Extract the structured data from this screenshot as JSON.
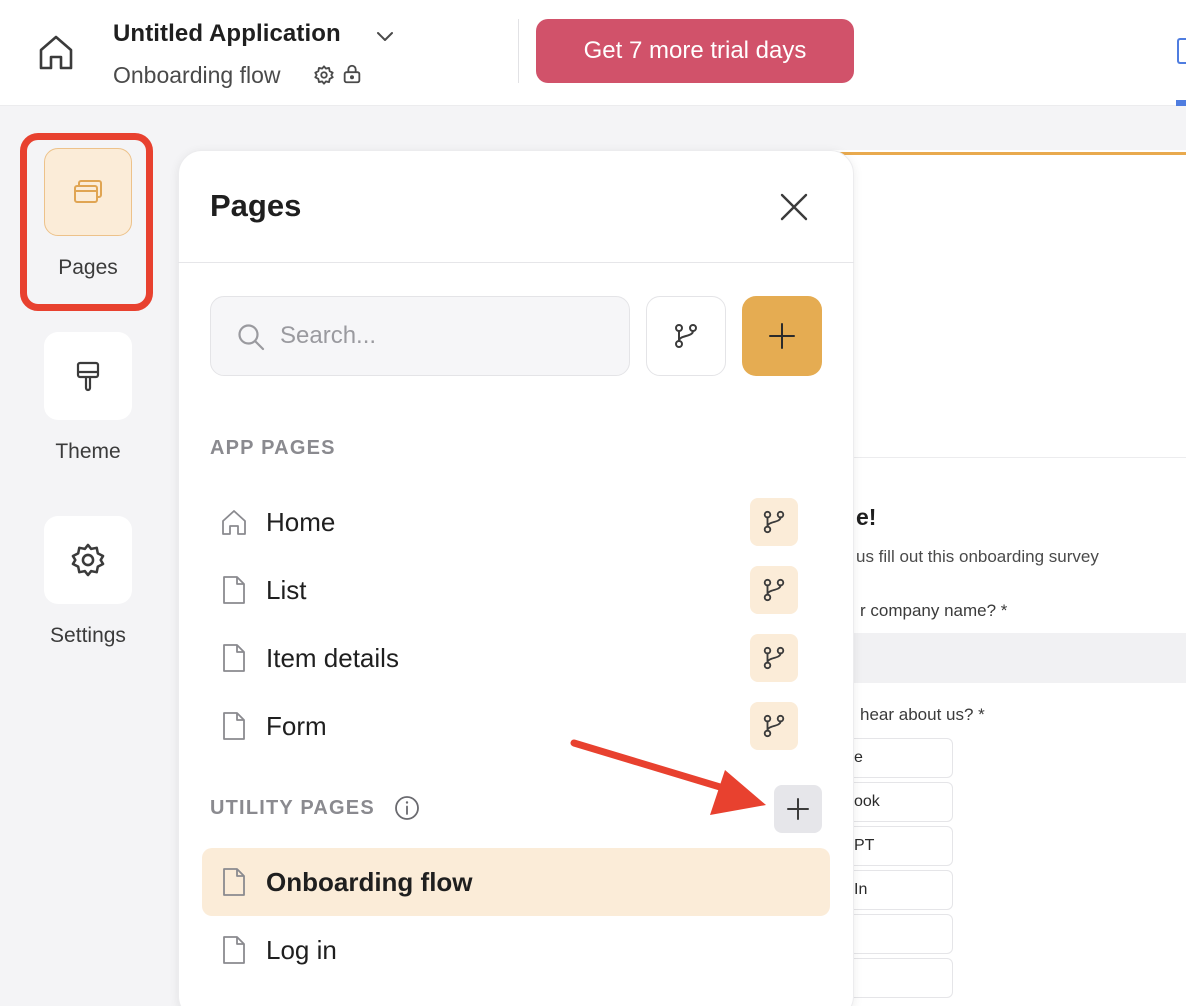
{
  "header": {
    "app_title": "Untitled Application",
    "flow_name": "Onboarding flow",
    "trial_button": "Get 7 more trial days"
  },
  "rail": {
    "items": [
      {
        "label": "Pages",
        "icon": "pages-icon",
        "active": true
      },
      {
        "label": "Theme",
        "icon": "paint-roller-icon",
        "active": false
      },
      {
        "label": "Settings",
        "icon": "gear-icon",
        "active": false
      }
    ]
  },
  "panel": {
    "title": "Pages",
    "search_placeholder": "Search...",
    "app_pages_heading": "APP PAGES",
    "app_pages": [
      {
        "label": "Home",
        "icon": "home-icon"
      },
      {
        "label": "List",
        "icon": "file-icon"
      },
      {
        "label": "Item details",
        "icon": "file-icon"
      },
      {
        "label": "Form",
        "icon": "file-icon"
      }
    ],
    "utility_pages_heading": "UTILITY PAGES",
    "utility_pages": [
      {
        "label": "Onboarding flow",
        "icon": "file-icon",
        "selected": true
      },
      {
        "label": "Log in",
        "icon": "file-icon",
        "selected": false
      }
    ]
  },
  "canvas": {
    "heading": "e!",
    "subtext": "us fill out this onboarding survey",
    "question1": "r company name? *",
    "question2": "hear about us? *",
    "options": [
      "e",
      "ook",
      "PT",
      "In",
      "",
      ""
    ]
  },
  "colors": {
    "accent_orange": "#e5ac52",
    "trial_pink": "#d1526a",
    "selected_bg": "#fbecd8",
    "annotation_red": "#e8412f"
  }
}
